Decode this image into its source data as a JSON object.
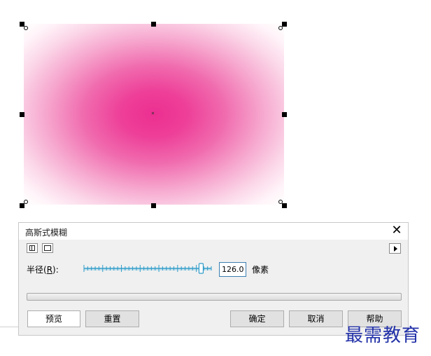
{
  "canvas": {
    "object_color": "#ec2f91"
  },
  "dialog": {
    "title": "高斯式模糊",
    "close_glyph": "✕",
    "toolbar": {
      "split_view_icon": "split-preview-icon",
      "single_view_icon": "single-preview-icon",
      "expand_icon": "expand-arrow-icon"
    },
    "radius": {
      "label_prefix": "半径(",
      "label_hotkey": "R",
      "label_suffix": "):",
      "value": "126.0",
      "unit": "像素",
      "slider_fraction": 0.92
    },
    "buttons": {
      "preview": "预览",
      "reset": "重置",
      "ok": "确定",
      "cancel": "取消",
      "help": "帮助"
    }
  },
  "watermark": "最需教育"
}
